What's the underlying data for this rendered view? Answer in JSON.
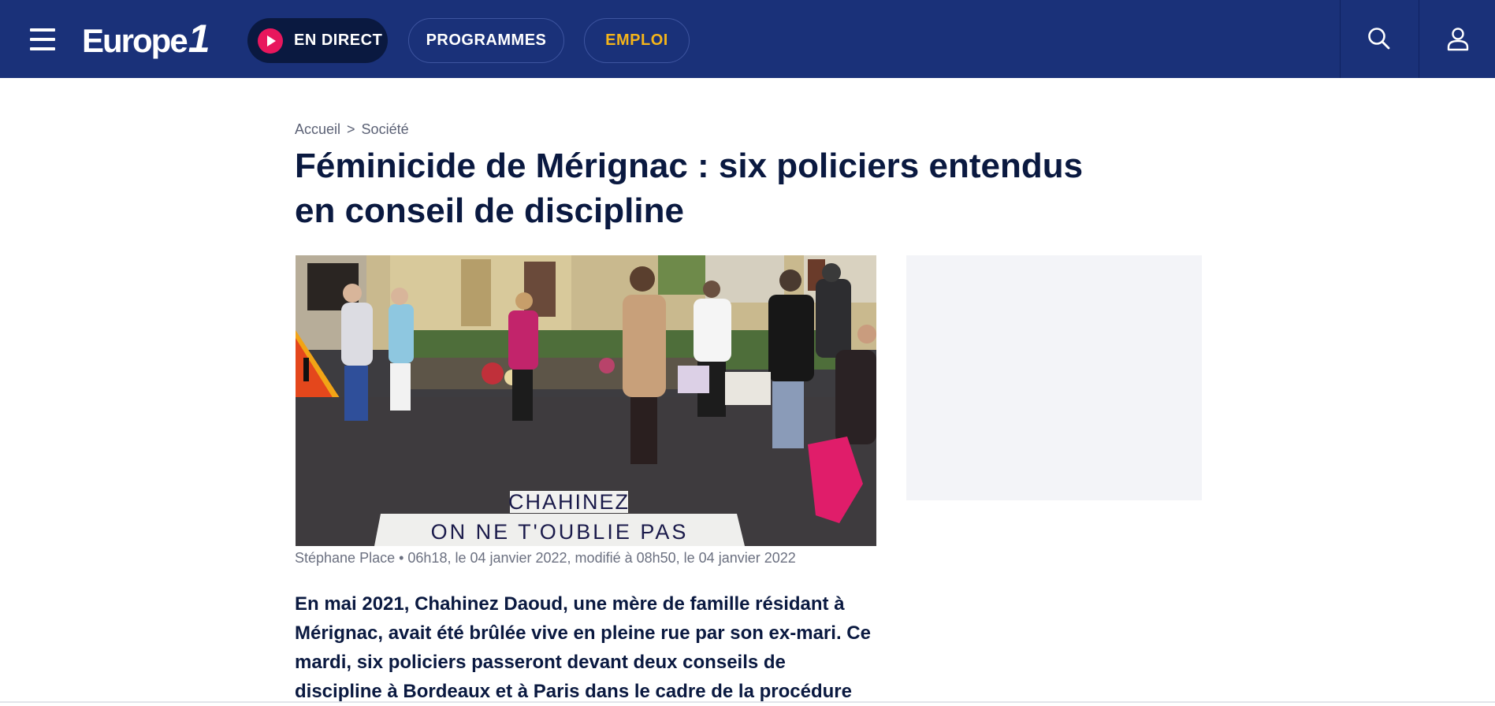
{
  "header": {
    "logo": {
      "text": "Europe",
      "number": "1"
    },
    "nav": {
      "live_label": "EN DIRECT",
      "programmes_label": "PROGRAMMES",
      "emploi_label": "EMPLOI"
    },
    "icons": {
      "menu": "hamburger-menu-icon",
      "search": "search-icon",
      "account": "user-icon",
      "live": "play-icon"
    },
    "colors": {
      "background": "#1a3179",
      "live_pill": "#0a1940",
      "live_dot": "#e8175d",
      "emploi": "#f4b41a"
    }
  },
  "breadcrumb": {
    "home": "Accueil",
    "separator": ">",
    "section": "Société"
  },
  "article": {
    "title": "Féminicide de Mérignac : six policiers entendus en conseil de discipline",
    "image": {
      "banner_line1": "CHAHINEZ",
      "banner_line2": "ON NE T'OUBLIE PAS"
    },
    "caption": "Stéphane Place • 06h18, le 04 janvier 2022, modifié à 08h50, le 04 janvier 2022",
    "lead": "En mai 2021, Chahinez Daoud, une mère de famille résidant à Mérignac, avait été brûlée vive en pleine rue par son ex-mari. Ce mardi, six policiers passeront devant deux conseils de discipline à Bordeaux et à Paris dans le cadre de la procédure"
  }
}
